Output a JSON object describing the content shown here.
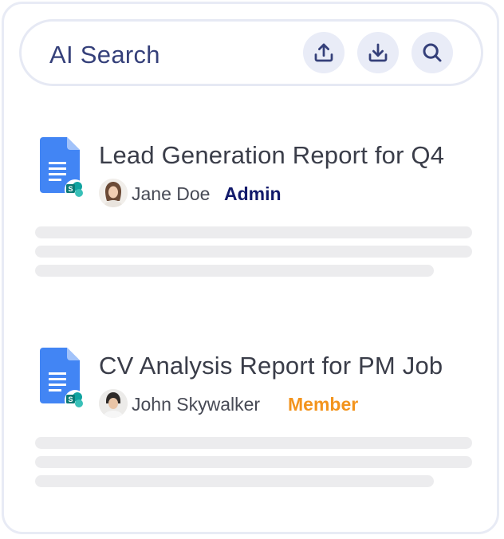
{
  "search": {
    "label": "AI Search"
  },
  "toolbar": {
    "upload_icon": "upload-icon",
    "download_icon": "download-icon",
    "search_icon": "search-icon"
  },
  "results": [
    {
      "title": "Lead Generation Report for Q4",
      "user": "Jane Doe",
      "role": "Admin",
      "role_color": "#121a6b",
      "file_icon": "google-docs-icon",
      "source_icon": "sharepoint-icon"
    },
    {
      "title": "CV Analysis Report for PM Job",
      "user": "John Skywalker",
      "role": "Member",
      "role_color": "#f3941d",
      "file_icon": "google-docs-icon",
      "source_icon": "sharepoint-icon"
    }
  ],
  "colors": {
    "accent": "#35407a",
    "doc_blue": "#4285f4",
    "sharepoint_teal": "#0b7a75",
    "skeleton": "#ececee"
  }
}
